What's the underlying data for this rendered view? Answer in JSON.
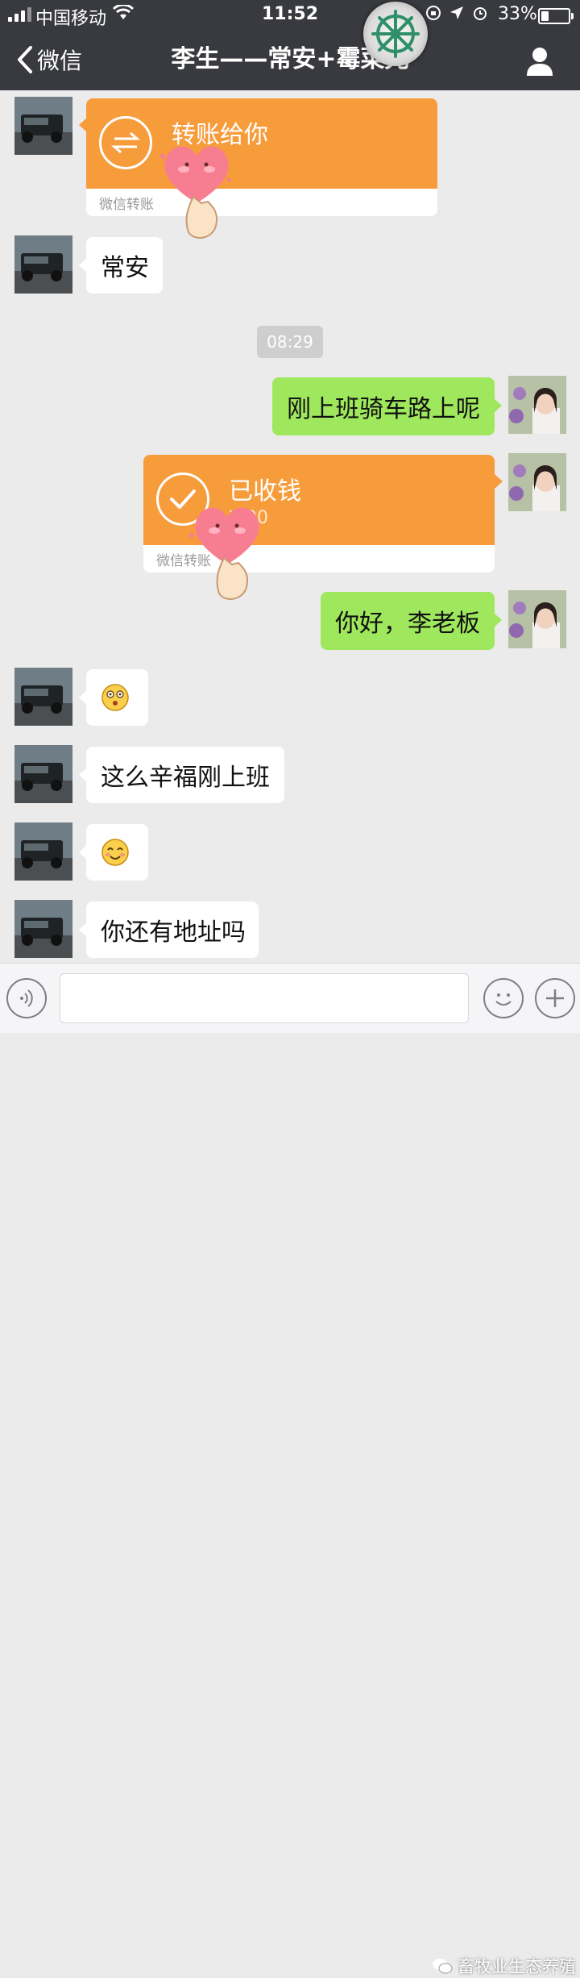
{
  "status_bar": {
    "carrier": "中国移动",
    "time": "11:52",
    "battery_percent": "33%",
    "battery_level": 0.33
  },
  "nav": {
    "back_label": "微信",
    "title": "李生——常安+霉菜兄"
  },
  "messages": [
    {
      "side": "in",
      "type": "transfer",
      "title": "转账给你",
      "footer": "微信转账"
    },
    {
      "side": "in",
      "type": "text",
      "text": "常安"
    },
    {
      "type": "time",
      "text": "08:29"
    },
    {
      "side": "out",
      "type": "text",
      "text": "刚上班骑车路上呢"
    },
    {
      "side": "out",
      "type": "transfer",
      "title": "已收钱",
      "amount": "¥.00",
      "footer": "微信转账"
    },
    {
      "side": "out",
      "type": "text",
      "text": "你好，李老板"
    },
    {
      "side": "in",
      "type": "emoji",
      "icon": "dizzy-face-emoji"
    },
    {
      "side": "in",
      "type": "text",
      "text": "这么辛福刚上班"
    },
    {
      "side": "in",
      "type": "emoji",
      "icon": "smiling-face-emoji"
    },
    {
      "side": "in",
      "type": "text",
      "text": "你还有地址吗"
    }
  ],
  "input": {
    "placeholder": ""
  },
  "watermark": "畜牧业生态养殖",
  "colors": {
    "nav_bg": "#393a3f",
    "chat_bg": "#ebebeb",
    "out_bubble": "#9fe75c",
    "transfer": "#f79c3b"
  }
}
